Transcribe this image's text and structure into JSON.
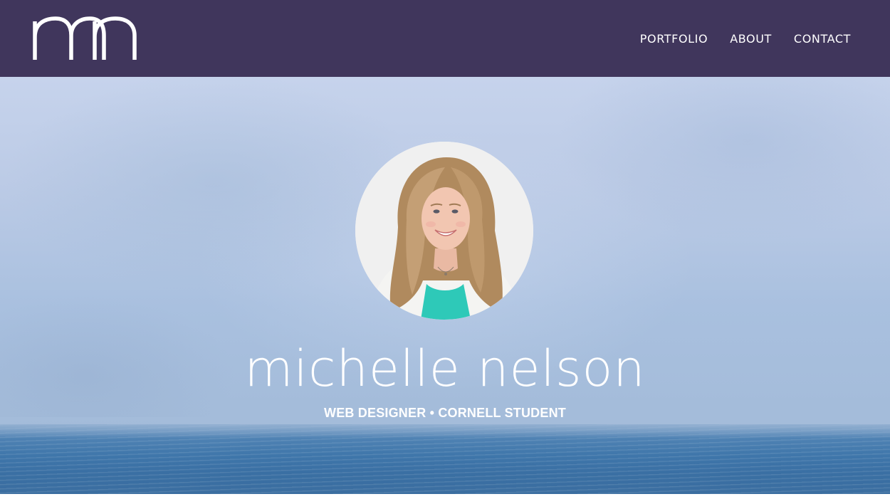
{
  "header": {
    "logo_text": "mn",
    "nav": [
      {
        "label": "PORTFOLIO"
      },
      {
        "label": "ABOUT"
      },
      {
        "label": "CONTACT"
      }
    ]
  },
  "hero": {
    "name": "michelle nelson",
    "tagline": "WEB DESIGNER • CORNELL STUDENT"
  },
  "colors": {
    "header_bg": "#40365c",
    "text": "#ffffff",
    "sea": "#3f76aa",
    "sky": "#bccbe6"
  }
}
